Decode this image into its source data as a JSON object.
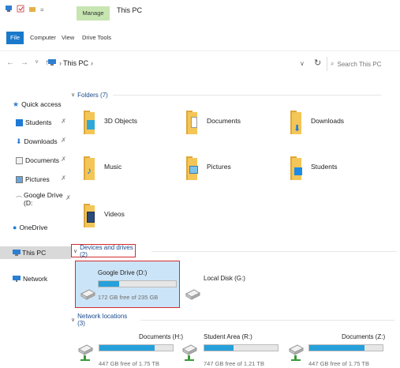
{
  "window": {
    "title": "This PC",
    "manage_tab": "Manage"
  },
  "ribbon": {
    "tabs": [
      "File",
      "Computer",
      "View",
      "Drive Tools"
    ]
  },
  "address": {
    "path": "This PC",
    "search_placeholder": "Search This PC"
  },
  "sidebar": {
    "items": [
      {
        "label": "Quick access",
        "icon": "star-icon",
        "pinned": false
      },
      {
        "label": "Students",
        "icon": "folder-icon",
        "pinned": true
      },
      {
        "label": "Downloads",
        "icon": "download-icon",
        "pinned": true
      },
      {
        "label": "Documents",
        "icon": "document-icon",
        "pinned": true
      },
      {
        "label": "Pictures",
        "icon": "pictures-icon",
        "pinned": true
      },
      {
        "label": "Google Drive (D:",
        "icon": "drive-icon",
        "pinned": true
      },
      {
        "label": "OneDrive",
        "icon": "cloud-icon",
        "pinned": false
      },
      {
        "label": "This PC",
        "icon": "computer-icon",
        "pinned": false,
        "selected": true
      },
      {
        "label": "Network",
        "icon": "network-icon",
        "pinned": false
      }
    ]
  },
  "groups": {
    "folders": {
      "header": "Folders (7)"
    },
    "devices": {
      "header": "Devices and drives (2)"
    },
    "network": {
      "header": "Network locations (3)"
    }
  },
  "folders": [
    {
      "name": "3D Objects"
    },
    {
      "name": "Documents"
    },
    {
      "name": "Downloads"
    },
    {
      "name": "Music"
    },
    {
      "name": "Pictures"
    },
    {
      "name": "Students"
    },
    {
      "name": "Videos"
    }
  ],
  "drives": [
    {
      "name": "Google Drive (D:)",
      "free": "172 GB free of 235 GB",
      "used_fraction": 0.27,
      "selected": true
    },
    {
      "name": "Local Disk (G:)",
      "free": "",
      "used_fraction": null
    }
  ],
  "network_locations": [
    {
      "name": "Documents (H:)",
      "free": "447 GB free of 1.75 TB",
      "used_fraction": 0.75
    },
    {
      "name": "Student Area (R:)",
      "free": "747 GB free of 1.21 TB",
      "used_fraction": 0.4
    },
    {
      "name": "Documents (Z:)",
      "free": "447 GB free of 1.75 TB",
      "used_fraction": 0.75
    }
  ],
  "colors": {
    "accent": "#1979ca",
    "drive_fill": "#26a0da",
    "highlight": "#d52b2b",
    "selected_bg": "#cce4f7",
    "manage_tab": "#c7e5b1"
  }
}
